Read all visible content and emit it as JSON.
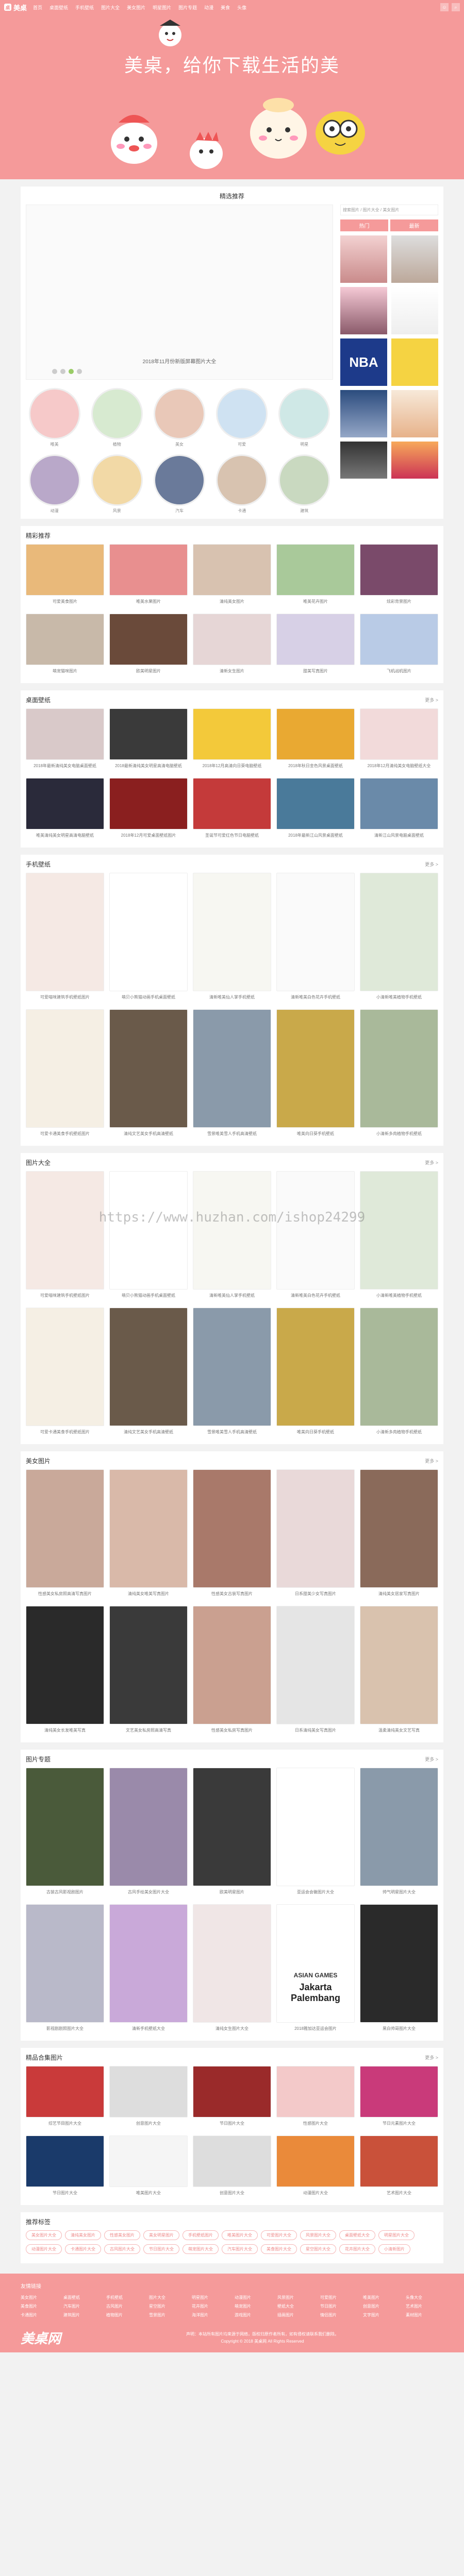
{
  "topbar": {
    "logo": "美桌",
    "nav": [
      "首页",
      "桌面壁纸",
      "手机壁纸",
      "图片大全",
      "美女图片",
      "明星图片",
      "图片专题",
      "动漫",
      "美食",
      "头像"
    ],
    "icons": [
      "user-icon",
      "search-icon"
    ]
  },
  "banner": {
    "title": "美桌，给你下载生活的美"
  },
  "picks": {
    "title": "精选推荐",
    "slide_caption": "2018年11月份新版屏幕图片大全",
    "side_title": "搜索图片 / 图片大全 / 美女图片",
    "tabs": [
      "热门",
      "最新"
    ],
    "circles": [
      "唯美",
      "植物",
      "美女",
      "可爱",
      "明星",
      "动漫",
      "风景",
      "汽车",
      "卡通",
      "建筑"
    ]
  },
  "featured": {
    "title": "精彩推荐",
    "items": [
      "可爱美食图片",
      "唯美水果图片",
      "清纯美女图片",
      "唯美花卉图片",
      "炫彩背景图片",
      "萌宠猫咪图片",
      "欧美明星图片",
      "清新女生图片",
      "甜美写真图片",
      "飞机战机图片"
    ]
  },
  "desktop": {
    "title": "桌面壁纸",
    "more": "更多 >",
    "items": [
      "2018年最新清纯美女电脑桌面壁纸",
      "2018最新清纯美女明星高清电脑壁纸",
      "2018年12月高清向日葵电脑壁纸",
      "2018年秋日金色风景桌面壁纸",
      "2018年12月清纯美女电脑壁纸大全",
      "唯美清纯美女明星高清电脑壁纸",
      "2018年12月可爱桌面壁纸图片",
      "圣诞节可爱红色节日电脑壁纸",
      "2018年最新江山风景桌面壁纸",
      "清新江山风景电脑桌面壁纸"
    ]
  },
  "mobile": {
    "title": "手机壁纸",
    "more": "更多 >",
    "items": [
      "可爱喵咪建筑手机壁纸图片",
      "萌贝小熊猫动画手机桌面壁纸",
      "清新唯美仙人掌手机壁纸",
      "清新唯美白色花卉手机壁纸",
      "小清新唯美植物手机壁纸",
      "可爱卡通美食手机壁纸图片",
      "清纯文艺美女手机高清壁纸",
      "雪景唯美雪人手机高清壁纸",
      "唯美向日葵手机壁纸",
      "小清新多肉植物手机壁纸"
    ]
  },
  "gallery": {
    "title": "图片大全",
    "more": "更多 >",
    "watermark": "https://www.huzhan.com/ishop24299",
    "items": [
      "可爱喵咪建筑手机壁纸图片",
      "萌贝小熊猫动画手机桌面壁纸",
      "清新唯美仙人掌手机壁纸",
      "清新唯美白色花卉手机壁纸",
      "小清新唯美植物手机壁纸",
      "可爱卡通美食手机壁纸图片",
      "清纯文艺美女手机高清壁纸",
      "雪景唯美雪人手机高清壁纸",
      "唯美向日葵手机壁纸",
      "小清新多肉植物手机壁纸"
    ]
  },
  "beauty": {
    "title": "美女图片",
    "more": "更多 >",
    "items": [
      "性感美女私房照高清写真图片",
      "清纯美女唯美写真图片",
      "性感美女古装写真图片",
      "日系甜美少女写真图片",
      "清纯美女居家写真图片",
      "清纯美女长发唯美写真",
      "文艺美女私房照高清写真",
      "性感美女私房写真图片",
      "日系清纯美女写真图片",
      "温柔清纯美女文艺写真"
    ]
  },
  "topics": {
    "title": "图片专题",
    "more": "更多 >",
    "items": [
      "古装古风影视剧图片",
      "古风手绘美女图片大全",
      "欧美明星图片",
      "亚运会会徽图片大全",
      "帅气明星图片大全",
      "影视剧剧照图片大全",
      "清新手机壁纸大全",
      "清纯女生图片大全",
      "2018雅加达亚运会图片",
      "黑白帅哥图片大全"
    ],
    "asian_games_text": "ASIAN GAMES",
    "jakarta_text": "Jakarta Palembang"
  },
  "curated": {
    "title": "精品合集图片",
    "more": "更多 >",
    "items": [
      "综艺节目图片大全",
      "创意图片大全",
      "节日图片大全",
      "性感图片大全",
      "节日元素图片大全",
      "节日图片大全",
      "唯美图片大全",
      "创意图片大全",
      "动漫图片大全",
      "艺术图片大全"
    ]
  },
  "tags": {
    "title": "推荐标签",
    "items": [
      "美女图片大全",
      "清纯美女图片",
      "性感美女图片",
      "美女明星图片",
      "手机壁纸图片",
      "唯美图片大全",
      "可爱图片大全",
      "风景图片大全",
      "桌面壁纸大全",
      "明星图片大全",
      "动漫图片大全",
      "卡通图片大全",
      "古风图片大全",
      "节日图片大全",
      "萌宠图片大全",
      "汽车图片大全",
      "美食图片大全",
      "星空图片大全",
      "花卉图片大全",
      "小清新图片"
    ]
  },
  "footer": {
    "links_title": "友情链接",
    "links": [
      "美女图片",
      "桌面壁纸",
      "手机壁纸",
      "图片大全",
      "明星图片",
      "动漫图片",
      "风景图片",
      "可爱图片",
      "唯美图片",
      "头像大全",
      "美食图片",
      "汽车图片",
      "古风图片",
      "星空图片",
      "花卉图片",
      "萌宠图片",
      "壁纸大全",
      "节日图片",
      "创意图片",
      "艺术图片",
      "卡通图片",
      "建筑图片",
      "植物图片",
      "雪景图片",
      "海洋图片",
      "游戏图片",
      "插画图片",
      "情侣图片",
      "文字图片",
      "素材图片"
    ],
    "logo": "美桌网",
    "info1": "声明：本站所有图片均来源于网络，版权归原作者所有，如有侵权请联系我们删除。",
    "info2": "Copyright © 2018 美桌网 All Rights Reserved"
  }
}
